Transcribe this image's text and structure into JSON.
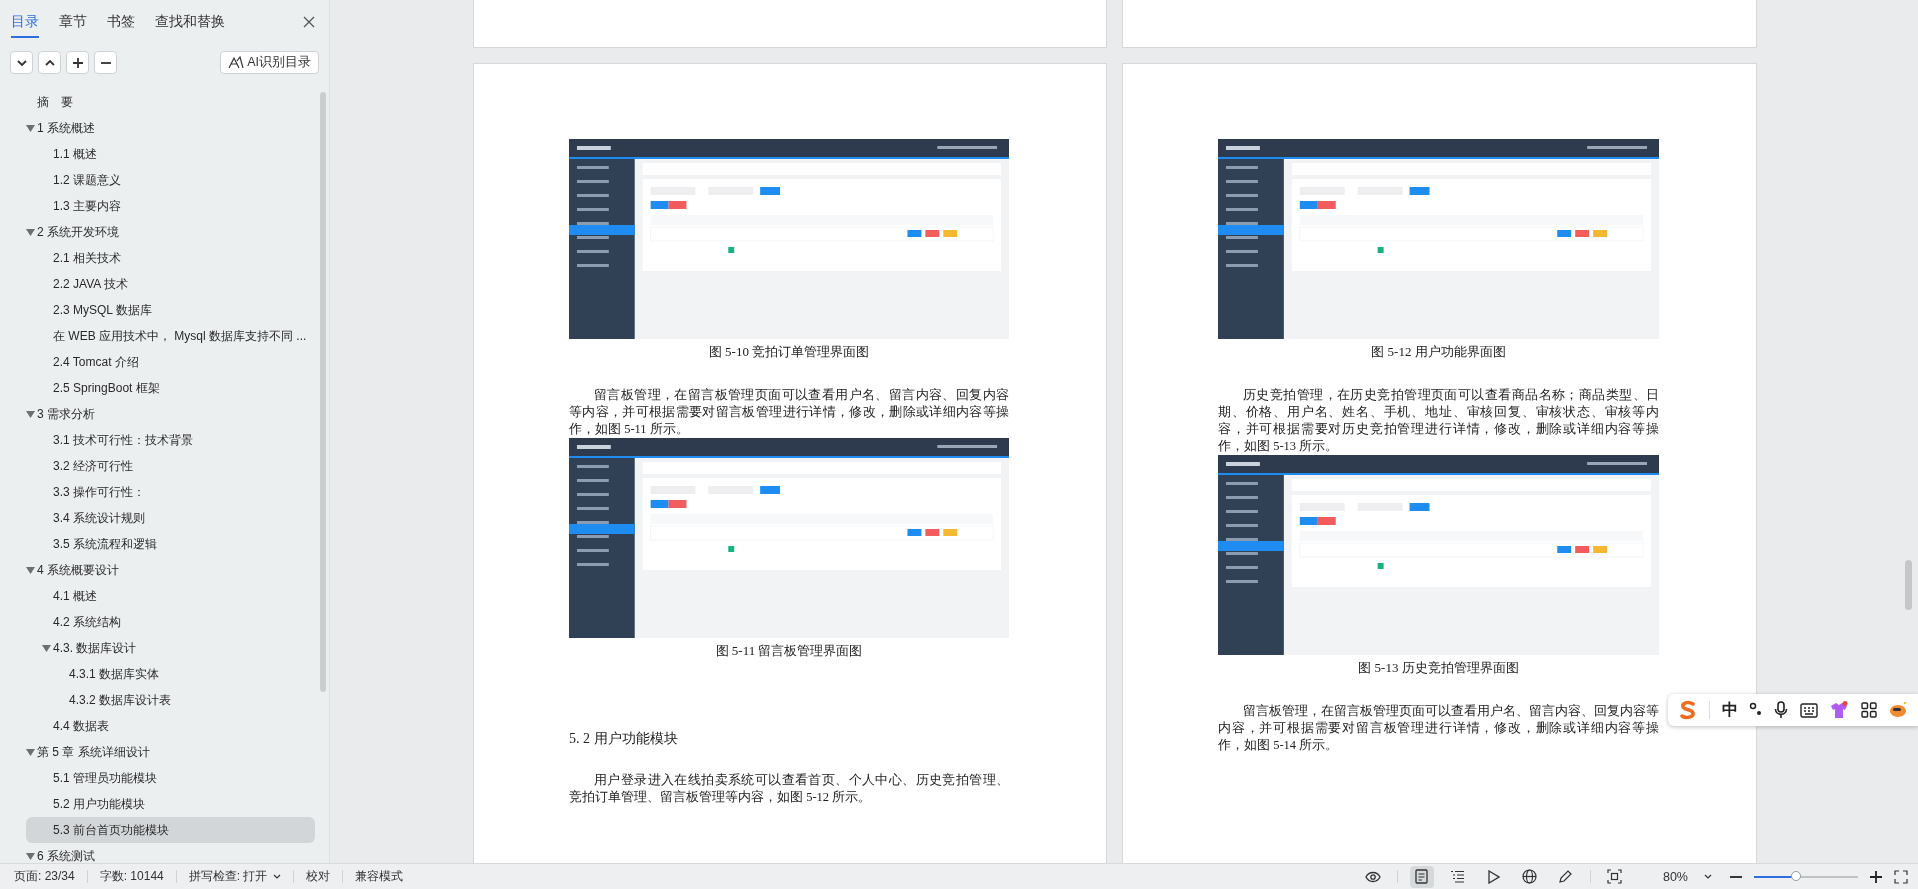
{
  "sidebar": {
    "tabs": [
      {
        "label": "目录",
        "selected": true
      },
      {
        "label": "章节",
        "selected": false
      },
      {
        "label": "书签",
        "selected": false
      },
      {
        "label": "查找和替换",
        "selected": false
      }
    ],
    "ai_button": "AI识别目录",
    "toc": [
      {
        "label": "摘　要",
        "selected": false
      },
      {
        "label": "1  系统概述",
        "selected": false,
        "expanded": true,
        "children": [
          {
            "label": "1.1  概述",
            "selected": false
          },
          {
            "label": "1.2 课题意义",
            "selected": false
          },
          {
            "label": "1.3  主要内容",
            "selected": false
          }
        ]
      },
      {
        "label": "2  系统开发环境",
        "selected": false,
        "expanded": true,
        "children": [
          {
            "label": "2.1 相关技术",
            "selected": false
          },
          {
            "label": "2.2 JAVA 技术",
            "selected": false
          },
          {
            "label": "2.3 MySQL 数据库",
            "selected": false
          },
          {
            "label": "在 WEB 应用技术中， Mysql 数据库支持不同 ...",
            "selected": false
          },
          {
            "label": "2.4 Tomcat 介绍",
            "selected": false
          },
          {
            "label": "2.5 SpringBoot 框架",
            "selected": false
          }
        ]
      },
      {
        "label": "3  需求分析",
        "selected": false,
        "expanded": true,
        "children": [
          {
            "label": "3.1 技术可行性：技术背景",
            "selected": false
          },
          {
            "label": "3.2 经济可行性",
            "selected": false
          },
          {
            "label": "3.3 操作可行性：",
            "selected": false
          },
          {
            "label": "3.4 系统设计规则",
            "selected": false
          },
          {
            "label": "3.5 系统流程和逻辑",
            "selected": false
          }
        ]
      },
      {
        "label": "4 系统概要设计",
        "selected": false,
        "expanded": true,
        "children": [
          {
            "label": "4.1  概述",
            "selected": false
          },
          {
            "label": "4.2  系统结构",
            "selected": false
          },
          {
            "label": "4.3.  数据库设计",
            "selected": false,
            "expanded": true,
            "children": [
              {
                "label": "4.3.1  数据库实体",
                "selected": false
              },
              {
                "label": "4.3.2  数据库设计表",
                "selected": false
              }
            ]
          },
          {
            "label": "4.4  数据表",
            "selected": false
          }
        ]
      },
      {
        "label": "第 5 章  系统详细设计",
        "selected": false,
        "expanded": true,
        "children": [
          {
            "label": "5.1 管理员功能模块",
            "selected": false
          },
          {
            "label": "5.2 用户功能模块",
            "selected": false
          },
          {
            "label": "5.3 前台首页功能模块",
            "selected": true
          }
        ]
      },
      {
        "label": "6  系统测试",
        "selected": false,
        "expanded": true
      }
    ]
  },
  "document": {
    "pages": [
      {
        "blocks": [
          {
            "kind": "figure"
          },
          {
            "kind": "caption",
            "text": "图 5-10 竞拍订单管理界面图"
          },
          {
            "kind": "paragraph",
            "text": "留言板管理，在留言板管理页面可以查看用户名、留言内容、回复内容等内容，并可根据需要对留言板管理进行详情，修改，删除或详细内容等操作，如图 5-11 所示。"
          },
          {
            "kind": "figure"
          },
          {
            "kind": "caption",
            "text": "图 5-11 留言板管理界面图"
          },
          {
            "kind": "heading",
            "text": "5. 2 用户功能模块"
          },
          {
            "kind": "paragraph",
            "text": "用户登录进入在线拍卖系统可以查看首页、个人中心、历史竞拍管理、竞拍订单管理、留言板管理等内容，如图 5-12 所示。"
          }
        ]
      },
      {
        "blocks": [
          {
            "kind": "figure"
          },
          {
            "kind": "caption",
            "text": "图 5-12 用户功能界面图"
          },
          {
            "kind": "paragraph",
            "text": "历史竞拍管理，在历史竞拍管理页面可以查看商品名称；商品类型、日期、价格、用户名、姓名、手机、地址、审核回复、审核状态、审核等内容，并可根据需要对历史竞拍管理进行详情，修改，删除或详细内容等操作，如图 5-13 所示。"
          },
          {
            "kind": "figure"
          },
          {
            "kind": "caption",
            "text": "图 5-13 历史竞拍管理界面图"
          },
          {
            "kind": "paragraph",
            "text": "留言板管理，在留言板管理页面可以查看用户名、留言内容、回复内容等内容，并可根据需要对留言板管理进行详情，修改，删除或详细内容等操作，如图 5-14 所示。"
          }
        ]
      }
    ]
  },
  "status_bar": {
    "page": "页面: 23/34",
    "word_count": "字数: 10144",
    "spell_check": "拼写检查: 打开",
    "proofread": "校对",
    "compat_mode": "兼容模式",
    "views": [
      {
        "selected": false
      },
      {
        "selected": true
      },
      {
        "selected": false
      },
      {
        "selected": false
      },
      {
        "selected": false
      },
      {
        "selected": false
      }
    ],
    "zoom": "80%",
    "zoom_slider": {
      "level": 0.4
    }
  },
  "ime_toolbar": {
    "mode": "中"
  }
}
